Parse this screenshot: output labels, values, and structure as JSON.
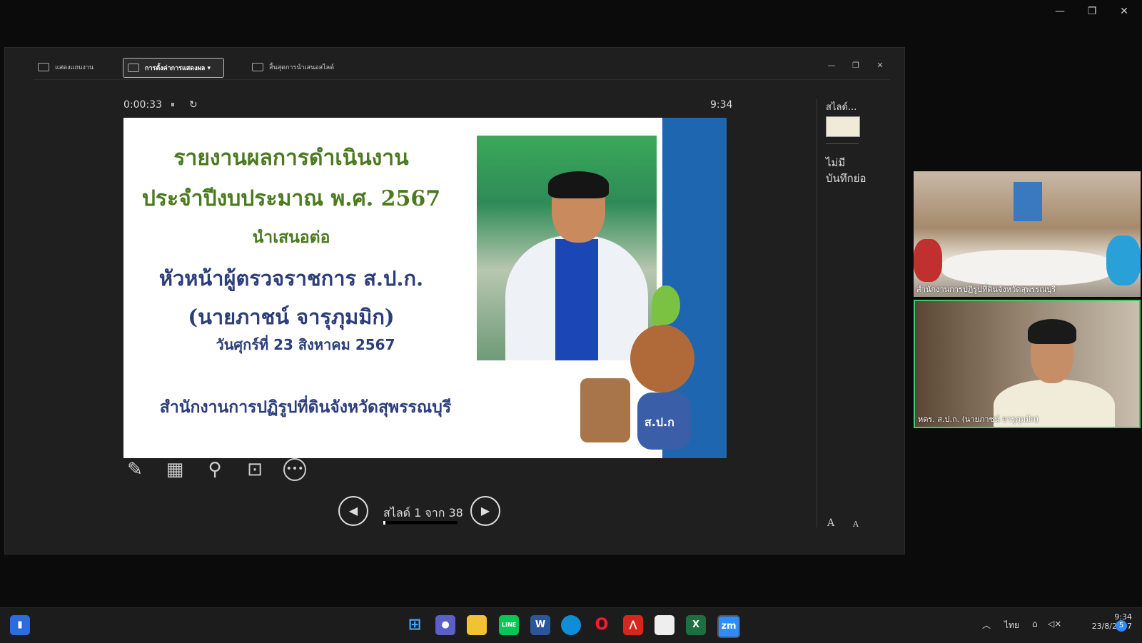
{
  "window": {
    "minimize_glyph": "—",
    "restore_glyph": "❐",
    "close_glyph": "✕"
  },
  "toolbar": {
    "show_taskbar_label": "แสดงแถบงาน",
    "display_settings_label": "การตั้งค่าการแสดงผล ▾",
    "end_slideshow_label": "สิ้นสุดการนำเสนอสไลด์"
  },
  "presenter": {
    "elapsed_time": "0:00:33",
    "pause_glyph": "⏸",
    "restart_glyph": "↻",
    "clock": "9:34",
    "slide_counter": "สไลด์ 1 จาก 38",
    "progress_fraction": 0.026,
    "prev_glyph": "◀",
    "next_glyph": "▶"
  },
  "slide": {
    "line1": "รายงานผลการดำเนินงาน",
    "line2": "ประจำปีงบประมาณ พ.ศ. 2567",
    "line3": "นำเสนอต่อ",
    "line4": "หัวหน้าผู้ตรวจราชการ ส.ป.ก.",
    "line5": "(นายภาชน์  จารุภุมมิก)",
    "line6": "วันศุกร์ที่ 23 สิงหาคม 2567",
    "line7": "สำนักงานการปฏิรูปที่ดินจังหวัดสุพรรณบุรี",
    "mascot_badge": "ส.ป.ก"
  },
  "sidebar": {
    "title": "สไลด์...",
    "notes_text": "ไม่มีบันทึกย่อ",
    "font_increase": "A",
    "font_decrease": "A"
  },
  "videos": [
    {
      "label": "สำนักงานการปฏิรูปที่ดินจังหวัดสุพรรณบุรี"
    },
    {
      "label": "หตร. ส.ป.ก. (นายภาชน์  จารุภุมมิก)"
    }
  ],
  "taskbar": {
    "zoom_label": "zm",
    "word_label": "W",
    "excel_label": "X",
    "language": "ไทย",
    "time": "9:34",
    "date": "23/8/2567",
    "notification_count": "5"
  },
  "colors": {
    "slide_title_green": "#4b7a1f",
    "slide_title_navy": "#2c3e7a",
    "slide_accent_blue": "#1e66b0",
    "active_speaker_border": "#3ecb6a"
  }
}
